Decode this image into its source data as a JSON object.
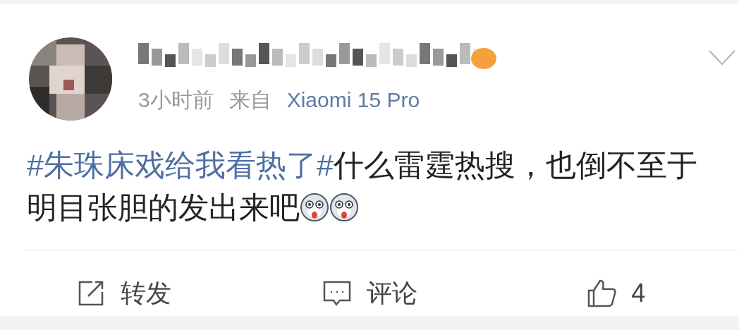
{
  "post": {
    "time": "3小时前",
    "source_prefix": "来自",
    "source": "Xiaomi 15 Pro",
    "hashtag": "#朱珠床戏给我看热了#",
    "text": "什么雷霆热搜，也倒不至于明目张胆的发出来吧"
  },
  "actions": [
    {
      "kind": "repost",
      "label": "转发"
    },
    {
      "kind": "comment",
      "label": "评论"
    },
    {
      "kind": "like",
      "label": "4"
    }
  ]
}
